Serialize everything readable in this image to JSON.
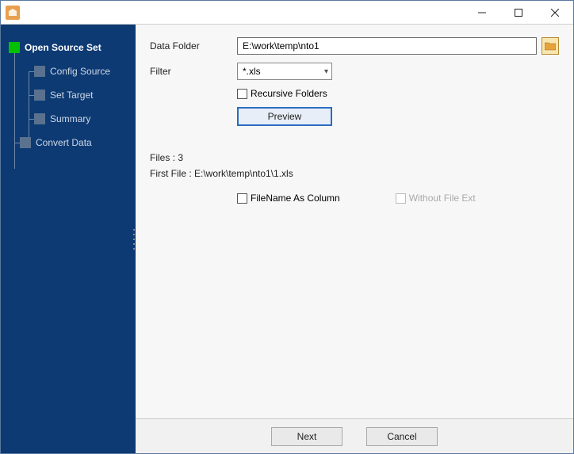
{
  "titlebar": {
    "title": ""
  },
  "sidebar": {
    "items": [
      {
        "label": "Open Source Set",
        "active": true
      },
      {
        "label": "Config Source"
      },
      {
        "label": "Set Target"
      },
      {
        "label": "Summary"
      },
      {
        "label": "Convert Data"
      }
    ]
  },
  "form": {
    "data_folder_label": "Data Folder",
    "data_folder_value": "E:\\work\\temp\\nto1",
    "filter_label": "Filter",
    "filter_value": "*.xls",
    "recursive_label": "Recursive Folders",
    "preview_label": "Preview"
  },
  "files": {
    "count_label": "Files : 3",
    "first_file_label": "First File : E:\\work\\temp\\nto1\\1.xls",
    "filename_as_column_label": "FileName As Column",
    "without_ext_label": "Without File Ext"
  },
  "footer": {
    "next_label": "Next",
    "cancel_label": "Cancel"
  }
}
